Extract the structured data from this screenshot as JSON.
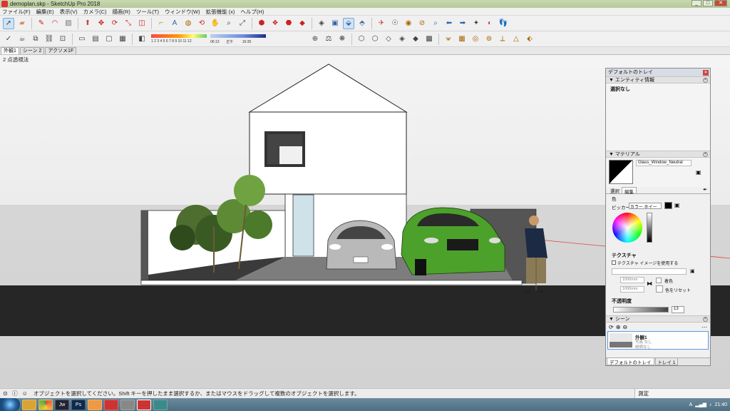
{
  "window": {
    "title": "demoplan.skp - SketchUp Pro 2018",
    "minimize": "_",
    "maximize": "□",
    "close": "✕"
  },
  "menu": [
    "ファイル(F)",
    "編集(E)",
    "表示(V)",
    "カメラ(C)",
    "描画(R)",
    "ツール(T)",
    "ウィンドウ(W)",
    "拡張機能 (x)",
    "ヘルプ(H)"
  ],
  "shadow": {
    "months": "1 2 3 4 5 6 7 8 9 10 11 12",
    "time_start": "06:13",
    "time_mid": "正午",
    "time_end": "16:35"
  },
  "tabs": [
    "外観1",
    "シーン 2",
    "アクソメ1F"
  ],
  "viewport": {
    "label": "2 点透視法"
  },
  "tray_panel": {
    "title": "デフォルトのトレイ",
    "entity": {
      "header": "エンティティ情報",
      "selection": "選択なし"
    },
    "material": {
      "header": "マテリアル",
      "name": "Glass_Window_Neutral",
      "tab_select": "選択",
      "tab_edit": "編集",
      "color_label": "色",
      "picker_label": "ピッカー:",
      "picker_value": "カラー ホイール"
    },
    "texture": {
      "header": "テクスチャ",
      "use_image": "テクスチャ イメージを使用する",
      "width": "1000mm",
      "height": "1000mm",
      "colorize": "着色",
      "reset_color": "色をリセット"
    },
    "opacity": {
      "header": "不透明度",
      "value": "13"
    },
    "scenes": {
      "header": "シーン",
      "scene_name": "外観1",
      "scene_line2": "写真 なし",
      "scene_line3": "説明なし"
    },
    "footer_tabs": [
      "デフォルトのトレイ",
      "トレイ 1"
    ]
  },
  "status": {
    "text": "オブジェクトを選択してください。Shift キーを押したまま選択するか、またはマウスをドラッグして複数のオブジェクトを選択します。",
    "measure_label": "測定"
  },
  "taskbar": {
    "clock": "21:40",
    "apps": [
      "",
      "",
      "Jw",
      "Ps",
      "",
      "",
      "",
      "",
      ""
    ]
  },
  "colors": {
    "ground_road": "#262626",
    "car_green": "#4ca12a",
    "car_silver": "#b9b9b9",
    "person_shirt": "#1d2a44",
    "person_pants": "#8a7a56"
  }
}
